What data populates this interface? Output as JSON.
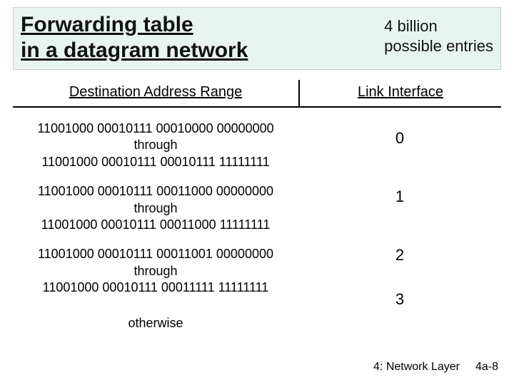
{
  "title": {
    "line1": "Forwarding table",
    "line2": "in a datagram network"
  },
  "annotation": {
    "line1": "4 billion",
    "line2": "possible entries"
  },
  "headers": {
    "range": "Destination Address Range",
    "iface": "Link Interface"
  },
  "rows": [
    {
      "from": "11001000 00010111 00010000 00000000",
      "mid": "through",
      "to": "11001000 00010111 00010111 11111111",
      "iface": "0"
    },
    {
      "from": "11001000 00010111 00011000 00000000",
      "mid": "through",
      "to": "11001000 00010111 00011000 11111111",
      "iface": "1"
    },
    {
      "from": "11001000 00010111 00011001 00000000",
      "mid": "through",
      "to": "11001000 00010111 00011111 11111111",
      "iface": "2"
    },
    {
      "from": "otherwise",
      "mid": "",
      "to": "",
      "iface": "3"
    }
  ],
  "footer": {
    "chapter": "4: Network Layer",
    "page": "4a-8"
  },
  "chart_data": {
    "type": "table",
    "title": "Forwarding table in a datagram network",
    "annotation": "4 billion possible entries",
    "columns": [
      "Destination Address Range",
      "Link Interface"
    ],
    "rows": [
      {
        "range_from": "11001000 00010111 00010000 00000000",
        "range_to": "11001000 00010111 00010111 11111111",
        "interface": 0
      },
      {
        "range_from": "11001000 00010111 00011000 00000000",
        "range_to": "11001000 00010111 00011000 11111111",
        "interface": 1
      },
      {
        "range_from": "11001000 00010111 00011001 00000000",
        "range_to": "11001000 00010111 00011111 11111111",
        "interface": 2
      },
      {
        "range_from": "otherwise",
        "range_to": null,
        "interface": 3
      }
    ]
  }
}
